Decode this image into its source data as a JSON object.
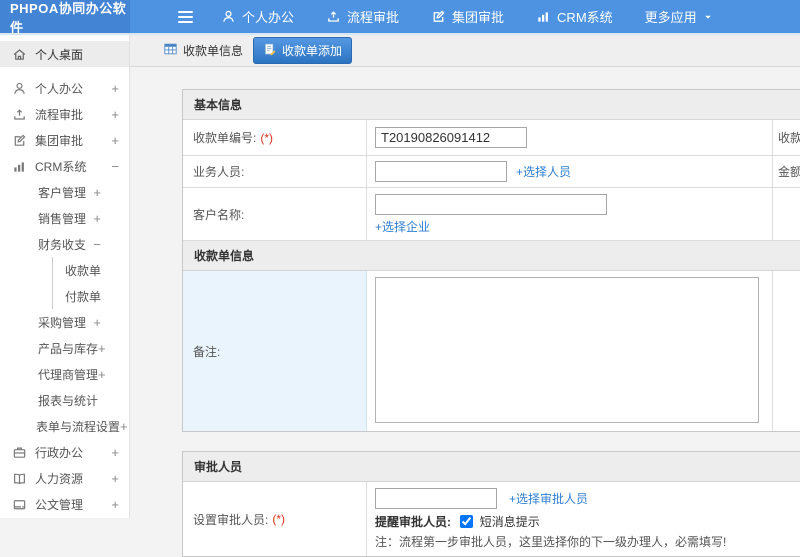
{
  "app": {
    "title": "PHPOA协同办公软件"
  },
  "colors": {
    "topbar": "#4e93e2",
    "logo_bg": "#4484d4",
    "active_tab": "#2d74c0",
    "link": "#2f7fd3",
    "required": "#e0301e",
    "remark_highlight": "#e9f4fd"
  },
  "topnav": {
    "items": [
      {
        "label": "个人办公",
        "icon": "user-icon"
      },
      {
        "label": "流程审批",
        "icon": "process-icon"
      },
      {
        "label": "集团审批",
        "icon": "edit-square-icon"
      },
      {
        "label": "CRM系统",
        "icon": "bar-chart-icon"
      },
      {
        "label": "更多应用",
        "icon": "caret-down-icon"
      }
    ]
  },
  "sidebar": {
    "items": [
      {
        "label": "个人桌面",
        "icon": "home-icon",
        "expand": "",
        "level": 0,
        "active": true
      },
      {
        "label": "个人办公",
        "icon": "user-icon",
        "expand": "+",
        "level": 0
      },
      {
        "label": "流程审批",
        "icon": "process-icon",
        "expand": "+",
        "level": 0
      },
      {
        "label": "集团审批",
        "icon": "edit-square-icon",
        "expand": "+",
        "level": 0
      },
      {
        "label": "CRM系统",
        "icon": "bar-chart-icon",
        "expand": "−",
        "level": 0
      },
      {
        "label": "客户管理",
        "expand": "+",
        "level": 1
      },
      {
        "label": "销售管理",
        "expand": "+",
        "level": 1
      },
      {
        "label": "财务收支",
        "expand": "−",
        "level": 1
      },
      {
        "label": "收款单",
        "expand": "",
        "level": 2
      },
      {
        "label": "付款单",
        "expand": "",
        "level": 2
      },
      {
        "label": "采购管理",
        "expand": "+",
        "level": 1
      },
      {
        "label": "产品与库存",
        "expand": "+",
        "level": 1
      },
      {
        "label": "代理商管理",
        "expand": "+",
        "level": 1
      },
      {
        "label": "报表与统计",
        "expand": "",
        "level": 1
      },
      {
        "label": "表单与流程设置",
        "expand": "+",
        "level": 1
      },
      {
        "label": "行政办公",
        "icon": "briefcase-icon",
        "expand": "+",
        "level": 0
      },
      {
        "label": "人力资源",
        "icon": "book-icon",
        "expand": "+",
        "level": 0
      },
      {
        "label": "公文管理",
        "icon": "document-icon",
        "expand": "+",
        "level": 0
      }
    ]
  },
  "tabs": {
    "info": {
      "label": "收款单信息"
    },
    "add": {
      "label": "收款单添加"
    }
  },
  "form": {
    "section_basic": {
      "title": "基本信息"
    },
    "receipt_no": {
      "label": "收款单编号:",
      "required": "(*)",
      "value": "T20190826091412"
    },
    "receipt_date": {
      "label": "收款单日期:"
    },
    "salesperson": {
      "label": "业务人员:",
      "value": "",
      "link": "+选择人员"
    },
    "amount": {
      "label": "金额:"
    },
    "customer": {
      "label": "客户名称:",
      "value": "",
      "link": "+选择企业"
    },
    "section_receipt": {
      "title": "收款单信息"
    },
    "remark": {
      "label": "备注:",
      "value": ""
    },
    "section_approver": {
      "title": "审批人员"
    },
    "approver": {
      "label": "设置审批人员:",
      "required": "(*)",
      "value": "",
      "link": "+选择审批人员"
    },
    "remind": {
      "label": "提醒审批人员:",
      "checkbox_label": "短消息提示",
      "checked": true
    },
    "note": "注：流程第一步审批人员，这里选择你的下一级办理人，必需填写!"
  }
}
